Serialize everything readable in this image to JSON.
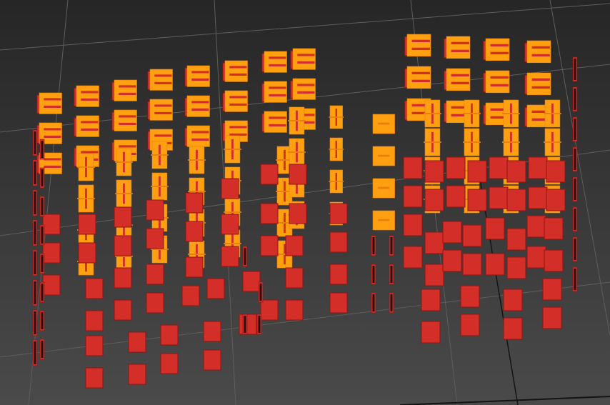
{
  "viewport": {
    "kind": "3d-viewport",
    "background_top": "#262626",
    "background_bottom": "#4a4a4a",
    "grid_color": "#5e5e5e",
    "grid_axis_color": "#141414"
  },
  "scene": {
    "object_kind": "window-grid-facade",
    "colors": {
      "panel_red": "#d42e29",
      "panel_red_edge": "#8e1713",
      "panel_orange": "#ffa010",
      "panel_orange_dark": "#e87e10",
      "panel_dark": "#2a1111"
    }
  }
}
